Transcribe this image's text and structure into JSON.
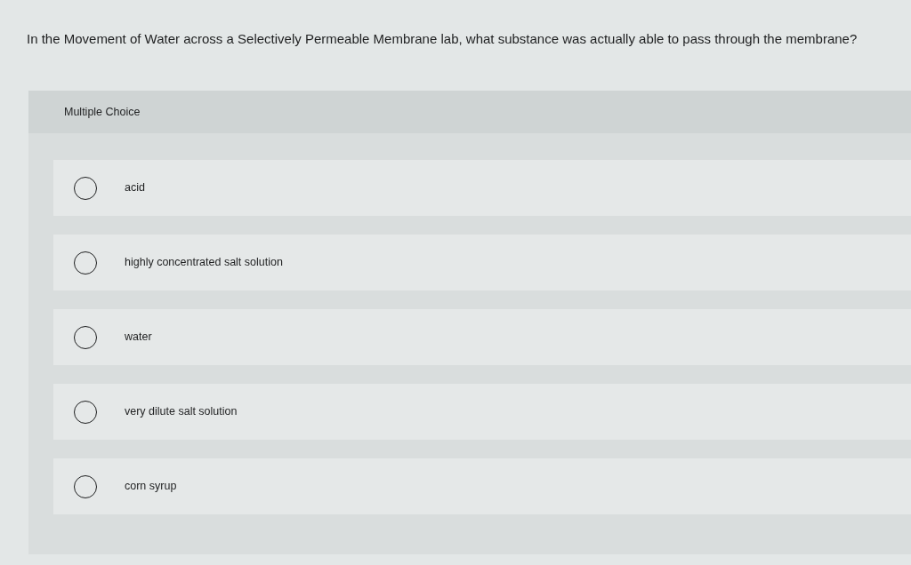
{
  "question": "In the Movement of Water across a Selectively Permeable Membrane lab, what substance was actually able to pass through the membrane?",
  "question_type": "Multiple Choice",
  "options": [
    {
      "label": "acid",
      "selected": false
    },
    {
      "label": "highly concentrated salt solution",
      "selected": false
    },
    {
      "label": "water",
      "selected": false
    },
    {
      "label": "very dilute salt solution",
      "selected": false
    },
    {
      "label": "corn syrup",
      "selected": false
    }
  ]
}
